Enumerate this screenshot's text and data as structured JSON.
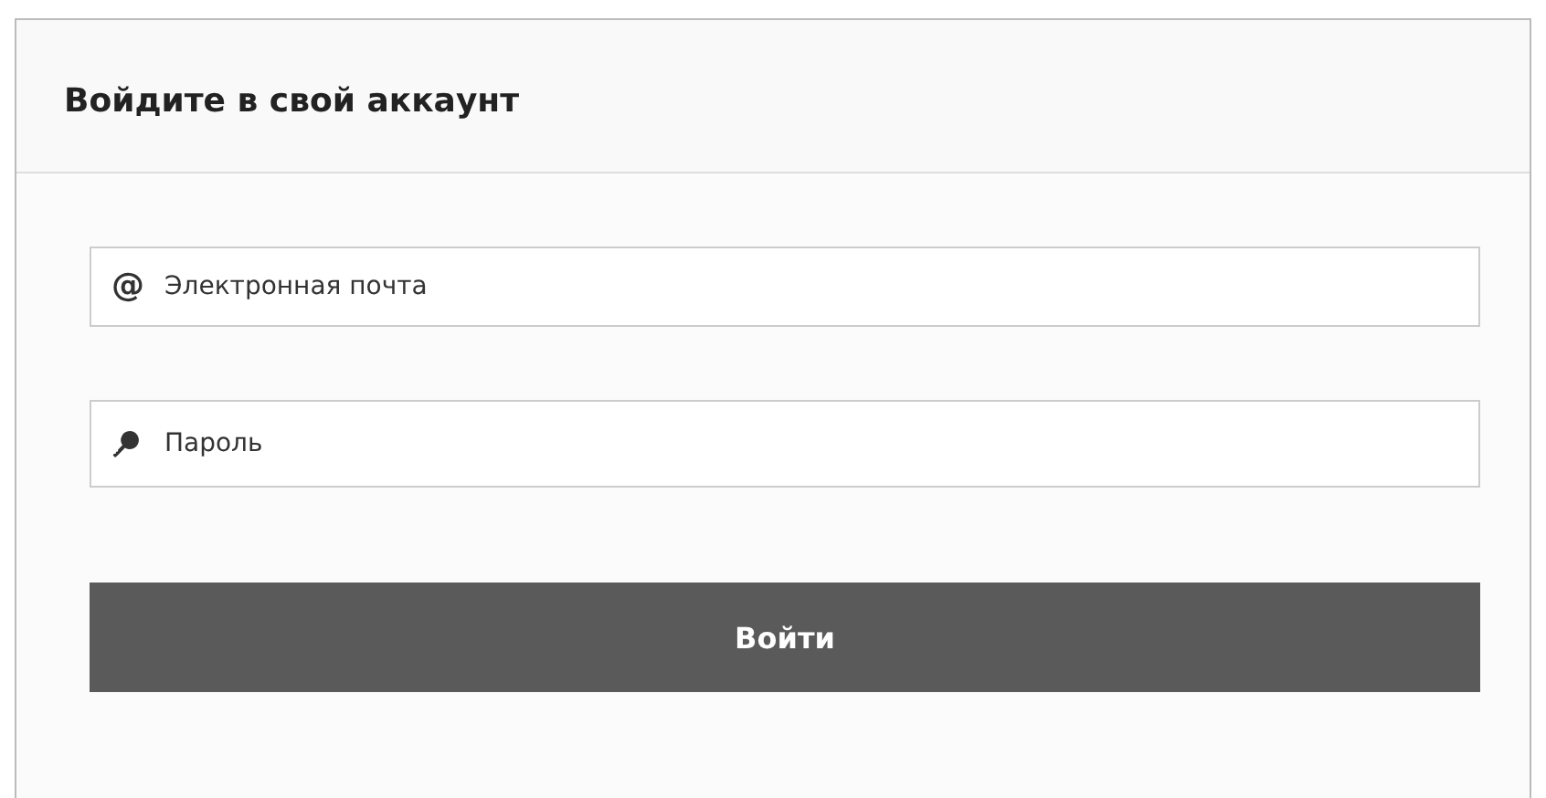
{
  "header": {
    "title": "Войдите в свой аккаунт"
  },
  "fields": [
    {
      "kind": "email",
      "icon": "@",
      "placeholder": "Электронная почта"
    },
    {
      "kind": "password",
      "placeholder": "Пароль"
    }
  ],
  "submit": {
    "label": "Войти"
  }
}
